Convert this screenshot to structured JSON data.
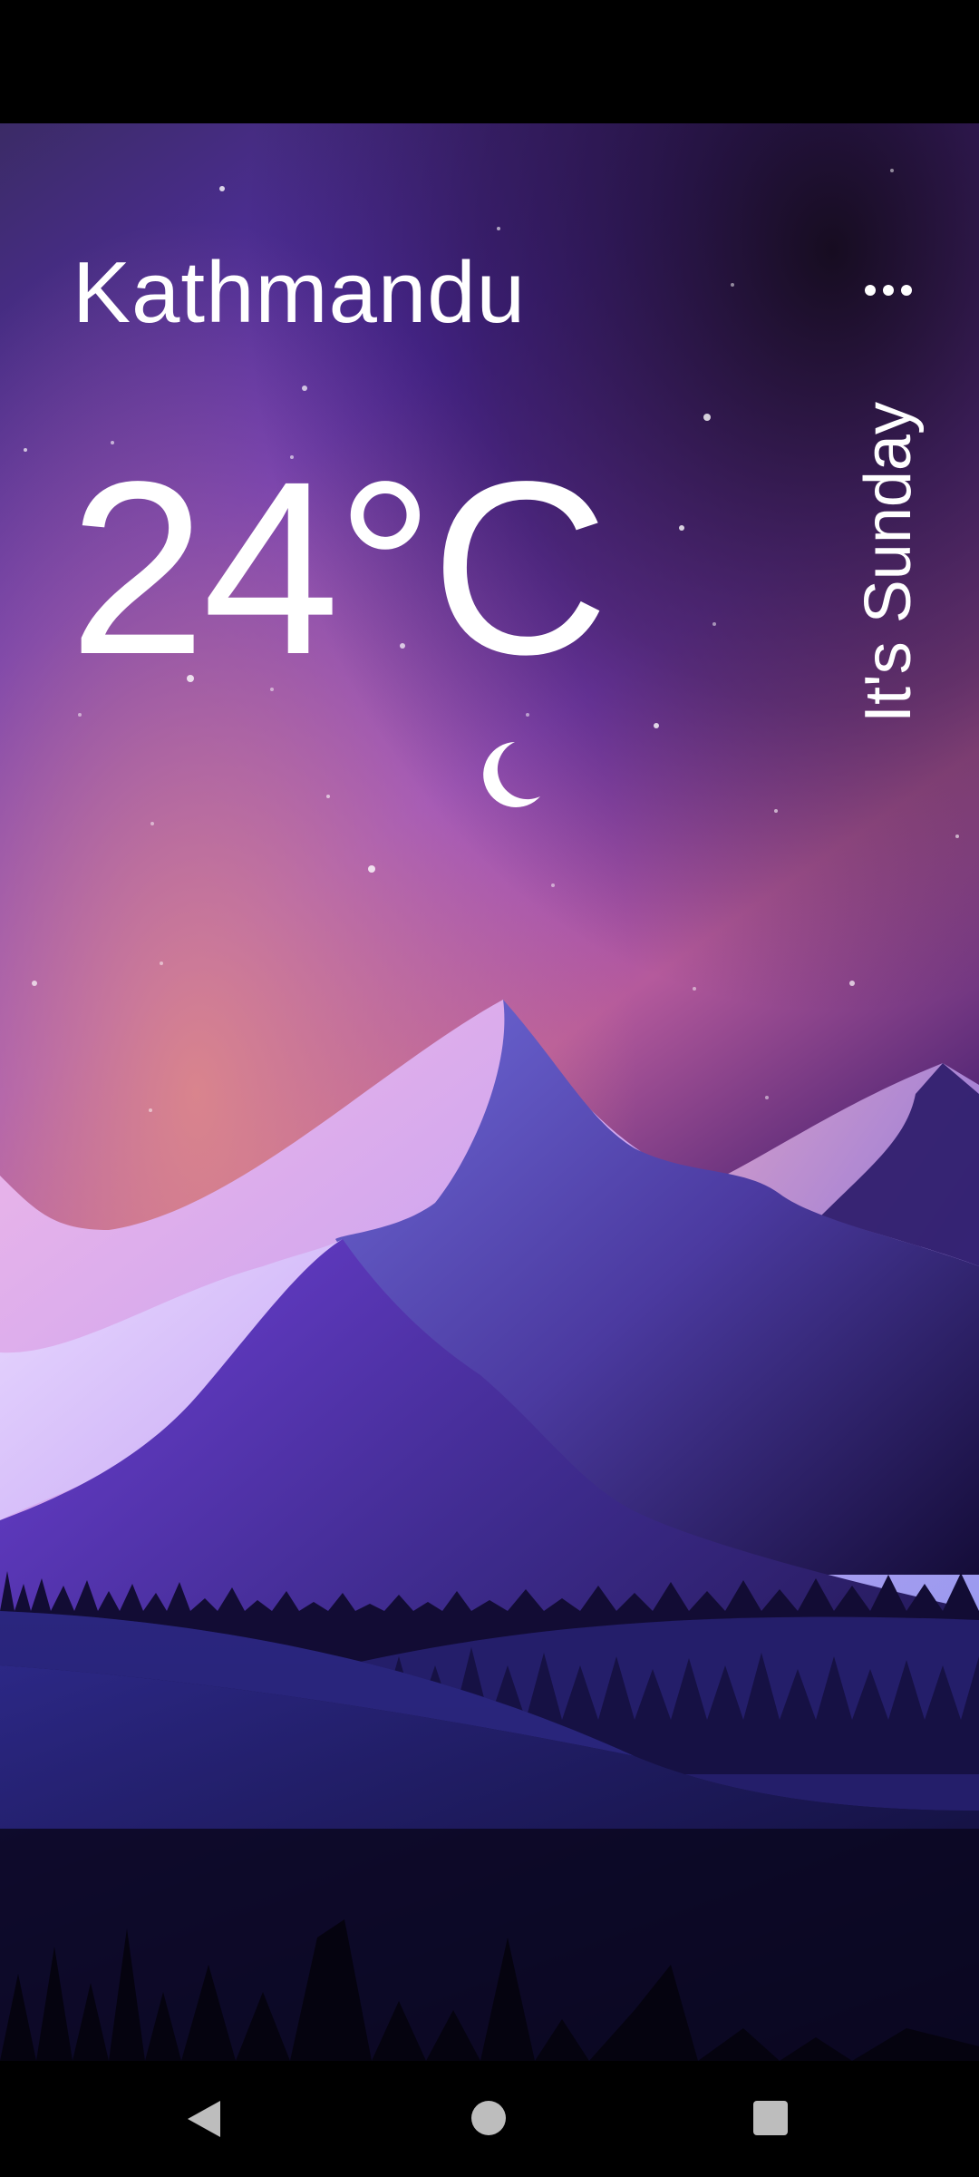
{
  "weather": {
    "city": "Kathmandu",
    "temperature": "24°C",
    "day_text": "It's Sunday",
    "condition_icon": "crescent-moon-icon"
  },
  "menu": {
    "icon": "more-horizontal-icon"
  },
  "navigation": {
    "back_icon": "triangle-back-icon",
    "home_icon": "circle-home-icon",
    "recents_icon": "square-recents-icon"
  },
  "colors": {
    "sky_top": "#3d2a6e",
    "sky_mid": "#6a2fc8",
    "glow": "#c86a8e",
    "night": "#0c0822",
    "text": "#ffffff"
  }
}
